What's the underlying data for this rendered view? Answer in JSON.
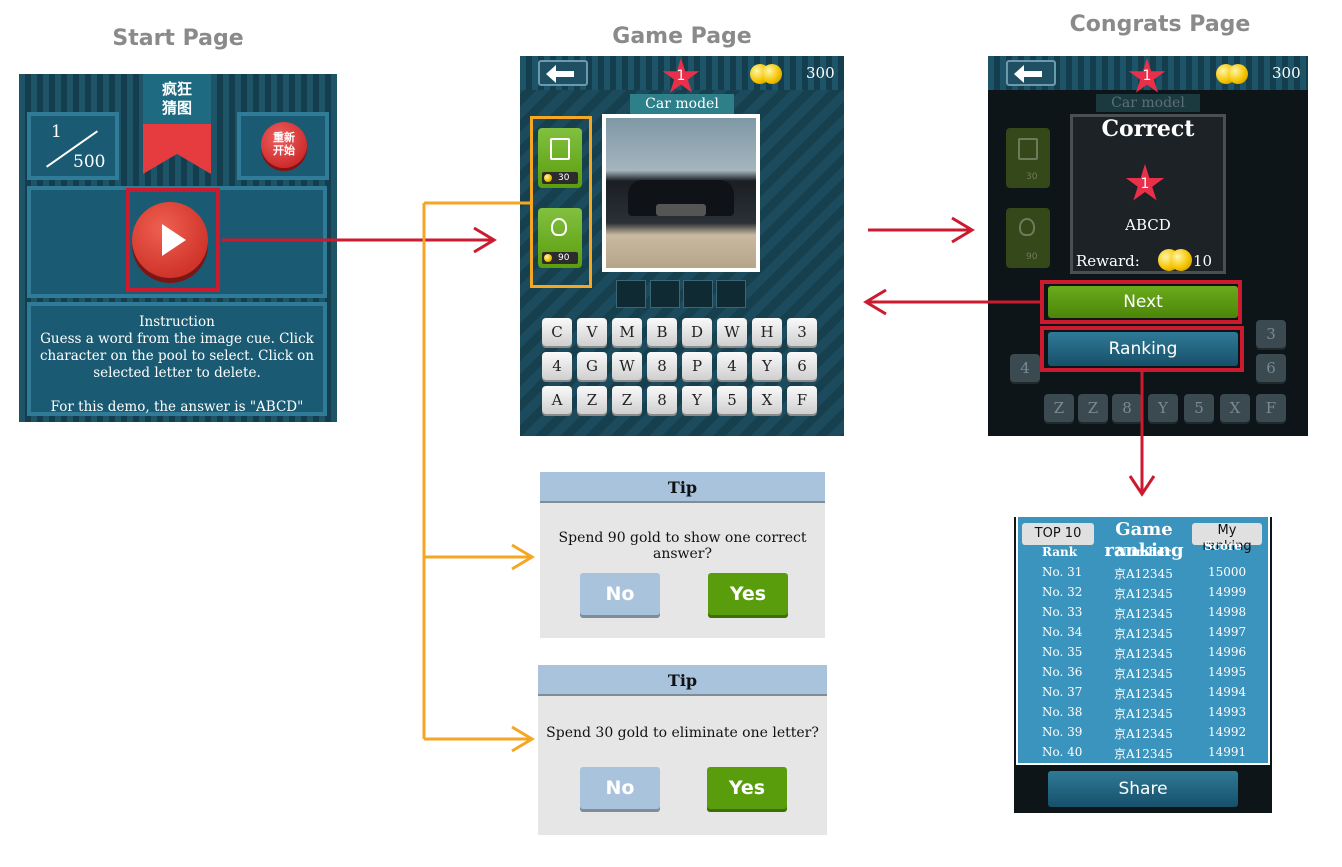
{
  "titles": {
    "start": "Start Page",
    "game": "Game Page",
    "congrats": "Congrats Page"
  },
  "start": {
    "logo": "疯狂\n猜图",
    "progress_num": "1",
    "progress_den": "500",
    "restart_label": "重新\n开始",
    "instruction_title": "Instruction",
    "instruction_body": "Guess a word from the image cue. Click character on the pool to select. Click on selected letter to delete.",
    "demo_note": "For this demo, the answer is \"ABCD\""
  },
  "game": {
    "level": "1",
    "coins": "300",
    "category": "Car model",
    "delete_cost": "30",
    "hint_cost": "90",
    "keys": [
      "C",
      "V",
      "M",
      "B",
      "D",
      "W",
      "H",
      "3",
      "4",
      "G",
      "W",
      "8",
      "P",
      "4",
      "Y",
      "6",
      "A",
      "Z",
      "Z",
      "8",
      "Y",
      "5",
      "X",
      "F"
    ]
  },
  "congrats": {
    "level": "1",
    "coins": "300",
    "category": "Car model",
    "correct": "Correct",
    "answer": "ABCD",
    "reward_label": "Reward:",
    "reward_value": "10",
    "delete_cost": "30",
    "hint_cost": "90",
    "next": "Next",
    "ranking": "Ranking",
    "bg_keys": [
      "3",
      "4",
      "6",
      "Z",
      "Z",
      "8",
      "Y",
      "5",
      "X",
      "F"
    ]
  },
  "tip1": {
    "title": "Tip",
    "message": "Spend 90 gold to show one correct answer?",
    "no": "No",
    "yes": "Yes"
  },
  "tip2": {
    "title": "Tip",
    "message": "Spend 30 gold to eliminate one letter?",
    "no": "No",
    "yes": "Yes"
  },
  "ranking": {
    "top10": "TOP 10",
    "title": "Game ranking",
    "my_ranking": "My ranking",
    "headers": [
      "Rank",
      "Number",
      "Score"
    ],
    "rows": [
      [
        "No. 31",
        "京A12345",
        "15000"
      ],
      [
        "No. 32",
        "京A12345",
        "14999"
      ],
      [
        "No. 33",
        "京A12345",
        "14998"
      ],
      [
        "No. 34",
        "京A12345",
        "14997"
      ],
      [
        "No. 35",
        "京A12345",
        "14996"
      ],
      [
        "No. 36",
        "京A12345",
        "14995"
      ],
      [
        "No. 37",
        "京A12345",
        "14994"
      ],
      [
        "No. 38",
        "京A12345",
        "14993"
      ],
      [
        "No. 39",
        "京A12345",
        "14992"
      ],
      [
        "No. 40",
        "京A12345",
        "14991"
      ]
    ],
    "share": "Share"
  },
  "colors": {
    "flow_red": "#cc1a2f",
    "flow_orange": "#f5a623",
    "teal": "#1a5a72",
    "green": "#5a9d0c",
    "tip_blue": "#a9c3dd"
  }
}
